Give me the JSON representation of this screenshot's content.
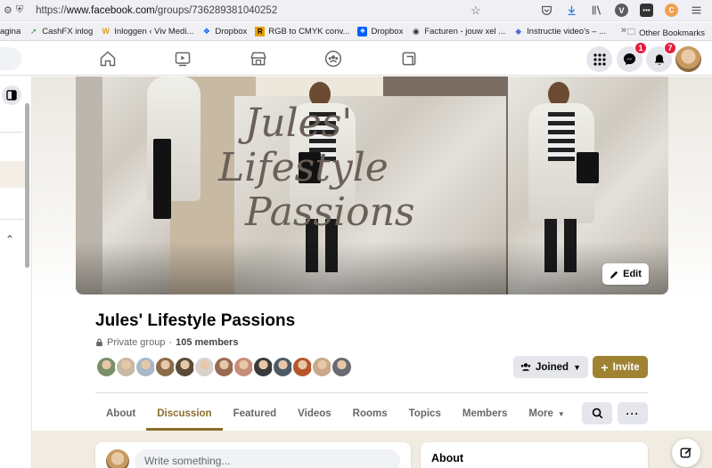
{
  "browser": {
    "url_prefix": "https://",
    "url_host": "www.facebook.com",
    "url_path": "/groups/736289381040252",
    "badge_v": "V",
    "badge_c": "C"
  },
  "bookmarks": {
    "items": [
      {
        "label": "agina"
      },
      {
        "label": "CashFX inlog"
      },
      {
        "label": "Inloggen ‹ Viv Medi..."
      },
      {
        "label": "Dropbox"
      },
      {
        "label": "RGB to CMYK conv..."
      },
      {
        "label": "Dropbox"
      },
      {
        "label": "Facturen - jouw xel ..."
      },
      {
        "label": "Instructie video's – ..."
      }
    ],
    "other": "Other Bookmarks"
  },
  "header": {
    "messenger_badge": "1",
    "notifications_badge": "7"
  },
  "group": {
    "name": "Jules' Lifestyle Passions",
    "privacy": "Private group",
    "separator": "·",
    "members": "105 members",
    "cover_script_lines": [
      "Jules'",
      "Lifestyle",
      "Passions"
    ],
    "edit_label": "Edit",
    "joined_label": "Joined",
    "invite_label": "Invite",
    "member_avatar_colors": [
      "#7a8f6a",
      "#c9b9a6",
      "#a9b8c8",
      "#8b6b4a",
      "#5a4a3a",
      "#d7d2cc",
      "#9a6a55",
      "#c68d7a",
      "#3a3a3a",
      "#4d5a66",
      "#b7562c",
      "#c9a98a",
      "#6a6a74"
    ]
  },
  "tabs": [
    {
      "label": "About",
      "active": false
    },
    {
      "label": "Discussion",
      "active": true
    },
    {
      "label": "Featured",
      "active": false
    },
    {
      "label": "Videos",
      "active": false
    },
    {
      "label": "Rooms",
      "active": false
    },
    {
      "label": "Topics",
      "active": false
    },
    {
      "label": "Members",
      "active": false
    },
    {
      "label": "More",
      "active": false
    }
  ],
  "composer": {
    "placeholder": "Write something..."
  },
  "about": {
    "title": "About"
  },
  "colors": {
    "accent": "#8a6d2b",
    "invite": "#a08233",
    "badge": "#e41e3f"
  }
}
